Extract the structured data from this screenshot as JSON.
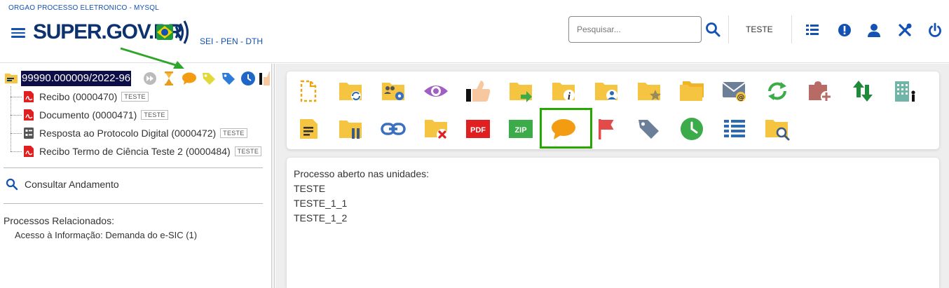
{
  "header": {
    "org_name": "ORGAO PROCESSO ELETRONICO - MYSQL",
    "logo_text": "SUPER.GOV.BR",
    "subtitle": "SEI - PEN - DTH",
    "search": {
      "placeholder": "Pesquisar...",
      "value": ""
    },
    "unit": "TESTE",
    "icons": [
      "menu-icon",
      "search-icon",
      "control-panel-icon",
      "alert-icon",
      "user-icon",
      "tools-icon",
      "power-icon"
    ]
  },
  "tree": {
    "process_number": "99990.000009/2022-96",
    "process_icons": [
      "process-folder-icon",
      "forward-icon",
      "hourglass-icon",
      "comment-icon",
      "tag-yellow-icon",
      "tag-blue-icon",
      "clock-icon",
      "marker-icon",
      "thumb-icon"
    ],
    "documents": [
      {
        "label": "Recibo (0000470)",
        "tag": "TESTE",
        "icon": "pdf-icon"
      },
      {
        "label": "Documento (0000471)",
        "tag": "TESTE",
        "icon": "pdf-icon"
      },
      {
        "label": "Resposta ao Protocolo Digital (0000472)",
        "tag": "TESTE",
        "icon": "form-icon"
      },
      {
        "label": "Recibo Termo de Ciência Teste 2 (0000484)",
        "tag": "TESTE",
        "icon": "pdf-icon"
      }
    ],
    "consult_label": "Consultar Andamento",
    "related_title": "Processos Relacionados:",
    "related_item": "Acesso à Informação: Demanda do e-SIC (1)"
  },
  "toolbar": {
    "row1": [
      "new-document-icon",
      "folder-sync-icon",
      "folder-users-settings-icon",
      "view-icon",
      "thumb-icon",
      "folder-send-icon",
      "folder-info-icon",
      "folder-user-icon",
      "folder-star-icon",
      "folders-icon",
      "email-icon",
      "refresh-icon",
      "add-block-icon",
      "relationships-icon",
      "building-user-icon"
    ],
    "row2": [
      "note-icon",
      "folder-pause-icon",
      "link-icon",
      "folder-cancel-icon",
      "pdf-export-icon",
      "zip-icon",
      "comment-icon",
      "flag-icon",
      "tag-icon",
      "clock-icon",
      "list-icon",
      "folder-search-icon"
    ],
    "pdf_text": "PDF",
    "zip_text": "ZIP",
    "colors": {
      "folder": "#f5c542",
      "green": "#3cab4a",
      "blue": "#2b6cb0",
      "comment": "#f39c12"
    }
  },
  "content": {
    "heading": "Processo aberto nas unidades:",
    "units": [
      "TESTE",
      "TESTE_1_1",
      "TESTE_1_2"
    ]
  },
  "annotation": {
    "arrow_color": "#2fa52b",
    "highlight_color": "#26a800"
  }
}
